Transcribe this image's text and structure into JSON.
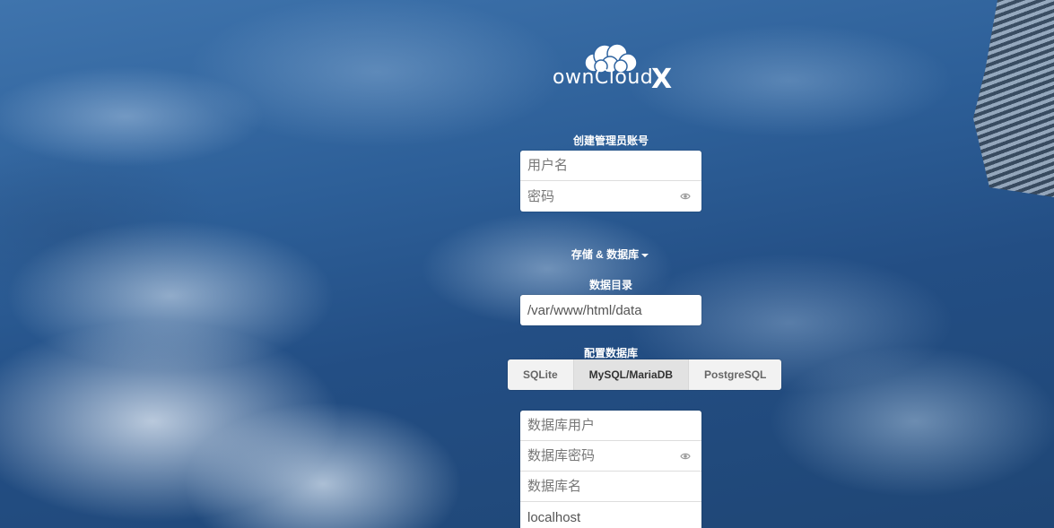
{
  "logo": {
    "text": "ownCloud",
    "x_text": "X"
  },
  "admin": {
    "heading": "创建管理员账号",
    "username_placeholder": "用户名",
    "password_placeholder": "密码"
  },
  "storage": {
    "toggle_label": "存储 & 数据库",
    "data_dir_label": "数据目录",
    "data_dir_value": "/var/www/html/data"
  },
  "database": {
    "config_label": "配置数据库",
    "tabs": [
      {
        "label": "SQLite",
        "active": false
      },
      {
        "label": "MySQL/MariaDB",
        "active": true
      },
      {
        "label": "PostgreSQL",
        "active": false
      }
    ],
    "user_placeholder": "数据库用户",
    "password_placeholder": "数据库密码",
    "name_placeholder": "数据库名",
    "host_value": "localhost"
  },
  "colors": {
    "background": "#2a5c91",
    "text": "#ffffff",
    "active_tab": "#e2e2e2"
  },
  "icons": {
    "password_toggle": "eye-icon",
    "dropdown": "caret-down-icon"
  }
}
